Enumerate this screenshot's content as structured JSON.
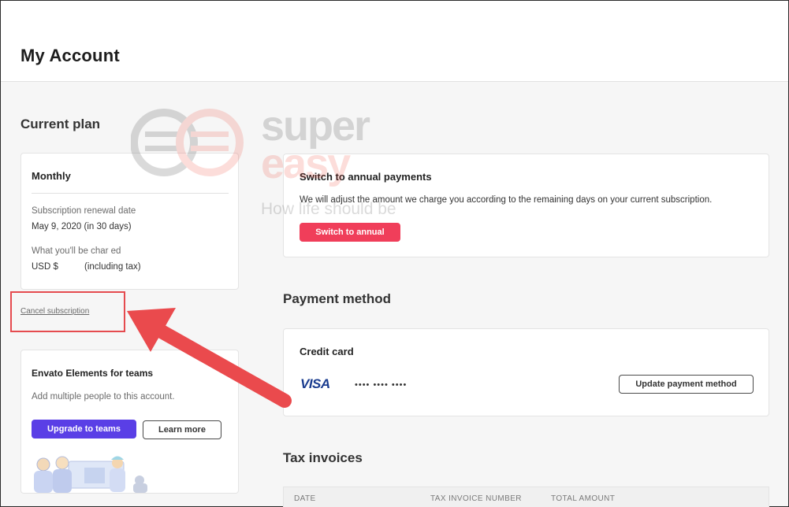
{
  "header": {
    "title": "My Account"
  },
  "current_plan": {
    "section_title": "Current plan",
    "plan_name": "Monthly",
    "renewal_label": "Subscription renewal date",
    "renewal_value": "May 9, 2020 (in 30 days)",
    "charge_label": "What you'll be char   ed",
    "charge_currency": "USD $",
    "charge_note": "(including tax)",
    "cancel_link": "Cancel subscription"
  },
  "teams": {
    "heading": "Envato Elements for teams",
    "description": "Add multiple people to this account.",
    "upgrade_button": "Upgrade to teams",
    "learn_more_button": "Learn more"
  },
  "annual": {
    "heading": "Switch to annual payments",
    "description": "We will adjust the amount we charge you according to the remaining days on your current subscription.",
    "button": "Switch to annual"
  },
  "payment": {
    "section_title": "Payment method",
    "card_heading": "Credit card",
    "card_brand": "VISA",
    "masked_number": "•••• •••• ••••",
    "update_button": "Update payment method"
  },
  "invoices": {
    "section_title": "Tax invoices",
    "columns": [
      "DATE",
      "TAX INVOICE NUMBER",
      "TOTAL AMOUNT"
    ]
  },
  "watermark": {
    "line1": "super",
    "line2": "easy",
    "tagline": "How life should be"
  },
  "colors": {
    "accent_red": "#f03e5a",
    "accent_purple": "#5a3fe6",
    "annotation_red": "#e54b4f",
    "visa_blue": "#1a3c8f"
  },
  "icons": {
    "annotation": "arrow-pointing-left-icon",
    "illustration": "team-people-illustration"
  }
}
